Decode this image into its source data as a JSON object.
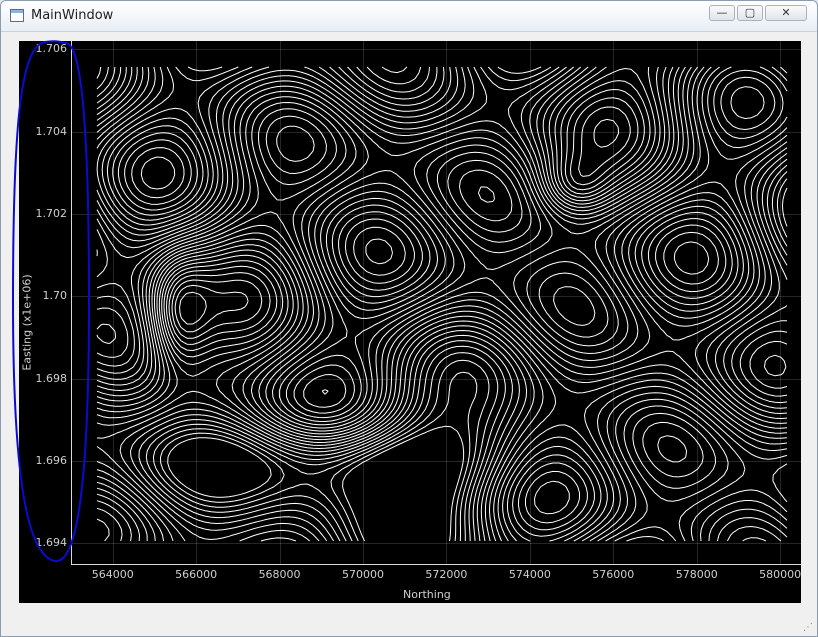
{
  "window": {
    "title": "MainWindow",
    "controls": {
      "minimize": "—",
      "maximize": "▢",
      "close": "✕"
    }
  },
  "chart_data": {
    "type": "contour",
    "xlabel": "Northing",
    "ylabel": "Easting (x1e+06)",
    "xlim": [
      563000,
      580500
    ],
    "ylim": [
      1.6935,
      1.7062
    ],
    "x_ticks": [
      "564000",
      "566000",
      "568000",
      "570000",
      "572000",
      "574000",
      "576000",
      "578000",
      "580000"
    ],
    "y_ticks": [
      "1.706",
      "1.704",
      "1.702",
      "1.70",
      "1.698",
      "1.696",
      "1.694"
    ],
    "grid": true,
    "colors": {
      "background": "#000000",
      "contour": "#ffffff",
      "annotation": "#0000cc"
    }
  }
}
